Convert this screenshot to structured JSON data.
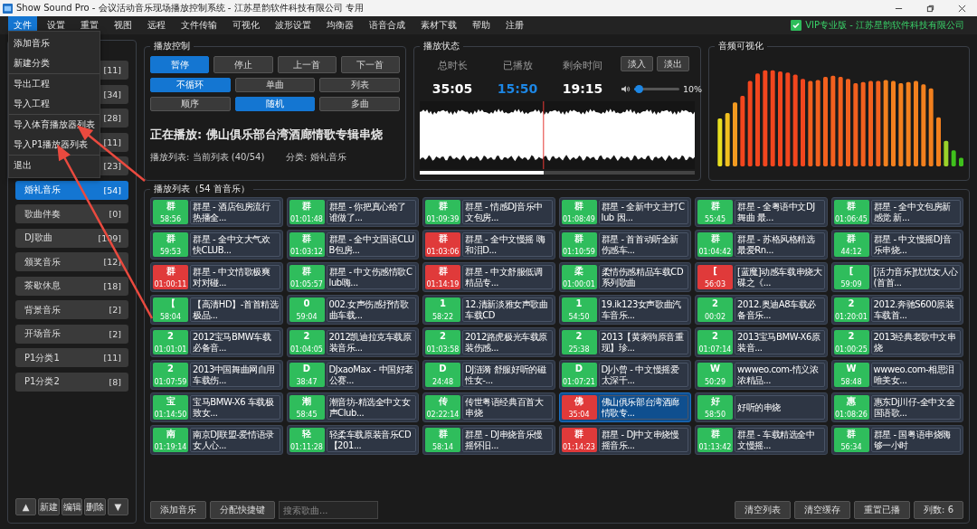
{
  "title_bar": {
    "title": "Show Sound Pro - 会议活动音乐现场播放控制系统 - 江苏星韵软件科技有限公司 专用"
  },
  "menu_bar": {
    "items": [
      {
        "label": "文件",
        "selected": true
      },
      {
        "label": "设置",
        "selected": false
      },
      {
        "label": "重置",
        "selected": false
      },
      {
        "label": "视图",
        "selected": false
      },
      {
        "label": "远程",
        "selected": false
      },
      {
        "label": "文件传输",
        "selected": false
      },
      {
        "label": "可视化",
        "selected": false
      },
      {
        "label": "波形设置",
        "selected": false
      },
      {
        "label": "均衡器",
        "selected": false
      },
      {
        "label": "语音合成",
        "selected": false
      },
      {
        "label": "素材下载",
        "selected": false
      },
      {
        "label": "帮助",
        "selected": false
      },
      {
        "label": "注册",
        "selected": false
      }
    ],
    "license": {
      "checked": true,
      "label": "VIP专业版 - 江苏星韵软件科技有限公司"
    }
  },
  "file_menu": {
    "groups": [
      [
        "添加音乐",
        "新建分类"
      ],
      [
        "导出工程",
        "导入工程"
      ],
      [
        "导入体育播放器列表",
        "导入P1播放器列表"
      ],
      [
        "退出"
      ]
    ]
  },
  "sidebar": {
    "categories": [
      {
        "count": "[11]",
        "selected": false
      },
      {
        "count": "[34]",
        "selected": false
      },
      {
        "count": "[28]",
        "selected": false
      },
      {
        "count": "[11]",
        "selected": false
      },
      {
        "count": "[23]",
        "selected": false
      },
      {
        "label": "婚礼音乐",
        "count": "[54]",
        "selected": true
      },
      {
        "label": "歌曲伴奏",
        "count": "[0]",
        "selected": false
      },
      {
        "label": "DJ歌曲",
        "count": "[109]",
        "selected": false
      },
      {
        "label": "颁奖音乐",
        "count": "[12]",
        "selected": false
      },
      {
        "label": "茶歇休息",
        "count": "[18]",
        "selected": false
      },
      {
        "label": "背景音乐",
        "count": "[2]",
        "selected": false
      },
      {
        "label": "开场音乐",
        "count": "[2]",
        "selected": false
      },
      {
        "label": "P1分类1",
        "count": "[11]",
        "selected": false
      },
      {
        "label": "P1分类2",
        "count": "[8]",
        "selected": false
      }
    ],
    "buttons": [
      "▲",
      "新建",
      "编辑",
      "删除",
      "▼"
    ]
  },
  "playback_control": {
    "title": "播放控制",
    "transport": [
      {
        "label": "暂停",
        "selected": true
      },
      {
        "label": "停止",
        "selected": false
      },
      {
        "label": "上一首",
        "selected": false
      },
      {
        "label": "下一首",
        "selected": false
      }
    ],
    "loop_modes": [
      {
        "label": "不循环",
        "selected": true
      },
      {
        "label": "单曲",
        "selected": false
      },
      {
        "label": "列表",
        "selected": false
      }
    ],
    "order_modes": [
      {
        "label": "顺序",
        "selected": false
      },
      {
        "label": "随机",
        "selected": true
      },
      {
        "label": "多曲",
        "selected": false
      }
    ],
    "now_playing": "正在播放: 佛山俱乐部台湾酒廊情歌专辑串烧",
    "playlist_info": "播放列表: 当前列表 (40/54)",
    "category_info": "分类: 婚礼音乐"
  },
  "playback_status": {
    "title": "播放状态",
    "stats": [
      {
        "label": "总时长",
        "value": "35:05",
        "highlight": false
      },
      {
        "label": "已播放",
        "value": "15:50",
        "highlight": true
      },
      {
        "label": "剩余时间",
        "value": "19:15",
        "highlight": false
      }
    ],
    "buttons": [
      "淡入",
      "淡出"
    ],
    "volume": {
      "level": 0.1,
      "reading": "10%"
    },
    "progress": {
      "level": 0.45
    }
  },
  "visualizer": {
    "title": "音频可视化"
  },
  "playlist": {
    "title": "播放列表（54 首音乐）",
    "tracks": [
      {
        "badge": "群",
        "duration": "58:56",
        "color": "#2fbd5c",
        "title": "群星 - 酒店包房流行热播全...",
        "selected": false
      },
      {
        "badge": "群",
        "duration": "01:01:48",
        "color": "#2fbd5c",
        "title": "群星 - 你把真心给了谁做了...",
        "selected": false
      },
      {
        "badge": "群",
        "duration": "01:09:39",
        "color": "#2fbd5c",
        "title": "群星 - 情感DJ音乐中文包房...",
        "selected": false
      },
      {
        "badge": "群",
        "duration": "01:08:49",
        "color": "#2fbd5c",
        "title": "群星 - 全新中文主打Club 因...",
        "selected": false
      },
      {
        "badge": "群",
        "duration": "55:45",
        "color": "#2fbd5c",
        "title": "群星 - 全粤语中文DJ舞曲 最...",
        "selected": false
      },
      {
        "badge": "群",
        "duration": "01:06:45",
        "color": "#2fbd5c",
        "title": "群星 - 全中文包房新感觉 新...",
        "selected": false
      },
      {
        "badge": "群",
        "duration": "59:53",
        "color": "#2fbd5c",
        "title": "群星 - 全中文大气欢快CLUB...",
        "selected": false
      },
      {
        "badge": "群",
        "duration": "01:03:12",
        "color": "#2fbd5c",
        "title": "群星 - 全中文国语CLUB包房...",
        "selected": false
      },
      {
        "badge": "群",
        "duration": "01:03:06",
        "color": "#e03a3a",
        "title": "群星 - 全中文慢摇 嗨和泪D...",
        "selected": false
      },
      {
        "badge": "群",
        "duration": "01:10:59",
        "color": "#2fbd5c",
        "title": "群星 - 首首动听全新伤感车...",
        "selected": false
      },
      {
        "badge": "群",
        "duration": "01:04:42",
        "color": "#2fbd5c",
        "title": "群星 - 苏格风格精选最爱Rn...",
        "selected": false
      },
      {
        "badge": "群",
        "duration": "44:12",
        "color": "#2fbd5c",
        "title": "群星 - 中文慢摇DJ音乐串烧...",
        "selected": false
      },
      {
        "badge": "群",
        "duration": "01:00:11",
        "color": "#e03a3a",
        "title": "群星 - 中文情歌极爽对对碰...",
        "selected": false
      },
      {
        "badge": "群",
        "duration": "01:05:57",
        "color": "#2fbd5c",
        "title": "群星 - 中文伤感情歌Club嗨...",
        "selected": false
      },
      {
        "badge": "群",
        "duration": "01:14:19",
        "color": "#e03a3a",
        "title": "群星 - 中文舒服低调精品专...",
        "selected": false
      },
      {
        "badge": "柔",
        "duration": "01:00:01",
        "color": "#2fbd5c",
        "title": "柔情伤感精品车载CD系列歌曲",
        "selected": false
      },
      {
        "badge": "[",
        "duration": "56:03",
        "color": "#e03a3a",
        "title": "[蓝魔]动感车载串烧大碟之《...",
        "selected": false
      },
      {
        "badge": "[",
        "duration": "59:09",
        "color": "#2fbd5c",
        "title": "[活力音乐]忧忧女人心(首首...",
        "selected": false
      },
      {
        "badge": "【",
        "duration": "58:04",
        "color": "#2fbd5c",
        "title": "【高清HD】-首首精选极品...",
        "selected": false
      },
      {
        "badge": "0",
        "duration": "59:04",
        "color": "#2fbd5c",
        "title": "002.女声伤感抒情歌曲车载...",
        "selected": false
      },
      {
        "badge": "1",
        "duration": "58:22",
        "color": "#2fbd5c",
        "title": "12.清新淡雅女声歌曲车载CD",
        "selected": false
      },
      {
        "badge": "1",
        "duration": "54:50",
        "color": "#2fbd5c",
        "title": "19.ik123女声歌曲汽车音乐...",
        "selected": false
      },
      {
        "badge": "2",
        "duration": "00:02",
        "color": "#2fbd5c",
        "title": "2012.奥迪A8车载必备音乐...",
        "selected": false
      },
      {
        "badge": "2",
        "duration": "01:20:01",
        "color": "#2fbd5c",
        "title": "2012.奔驰S600原装车载首...",
        "selected": false
      },
      {
        "badge": "2",
        "duration": "01:01:01",
        "color": "#2fbd5c",
        "title": "2012宝马BMW车载必备音...",
        "selected": false
      },
      {
        "badge": "2",
        "duration": "01:04:05",
        "color": "#2fbd5c",
        "title": "2012凯迪拉克车载原装音乐...",
        "selected": false
      },
      {
        "badge": "2",
        "duration": "01:03:58",
        "color": "#2fbd5c",
        "title": "2012路虎极光车载原装伤感...",
        "selected": false
      },
      {
        "badge": "2",
        "duration": "25:38",
        "color": "#2fbd5c",
        "title": "2013【黄家驹原音重现】珍...",
        "selected": false
      },
      {
        "badge": "2",
        "duration": "01:07:14",
        "color": "#2fbd5c",
        "title": "2013宝马BMW-X6原装音...",
        "selected": false
      },
      {
        "badge": "2",
        "duration": "01:00:25",
        "color": "#2fbd5c",
        "title": "2013经典老歌中文串烧",
        "selected": false
      },
      {
        "badge": "2",
        "duration": "01:07:59",
        "color": "#2fbd5c",
        "title": "2013中国舞曲网自用车载伤...",
        "selected": false
      },
      {
        "badge": "D",
        "duration": "38:47",
        "color": "#2fbd5c",
        "title": "DJxaoMax - 中国好老公赛...",
        "selected": false
      },
      {
        "badge": "D",
        "duration": "24:48",
        "color": "#2fbd5c",
        "title": "DJ涟漪 舒服好听的磁性女-...",
        "selected": false
      },
      {
        "badge": "D",
        "duration": "01:07:21",
        "color": "#2fbd5c",
        "title": "DJ小曾 - 中文慢摇爱太深千...",
        "selected": false
      },
      {
        "badge": "W",
        "duration": "50:29",
        "color": "#2fbd5c",
        "title": "wwweo.com-情义浓浓精品...",
        "selected": false
      },
      {
        "badge": "W",
        "duration": "58:48",
        "color": "#2fbd5c",
        "title": "wwweo.com-相思泪唯美女...",
        "selected": false
      },
      {
        "badge": "宝",
        "duration": "01:14:50",
        "color": "#2fbd5c",
        "title": "宝马BMW-X6 车载极致女...",
        "selected": false
      },
      {
        "badge": "潮",
        "duration": "58:45",
        "color": "#2fbd5c",
        "title": "潮音坊-精选全中文女声Club...",
        "selected": false
      },
      {
        "badge": "传",
        "duration": "02:22:14",
        "color": "#2fbd5c",
        "title": "传世粤语经典百首大串烧",
        "selected": false
      },
      {
        "badge": "佛",
        "duration": "35:04",
        "color": "#e03a3a",
        "title": "佛山俱乐部台湾酒廊情歌专...",
        "selected": true
      },
      {
        "badge": "好",
        "duration": "58:50",
        "color": "#2fbd5c",
        "title": "好听的串烧",
        "selected": false
      },
      {
        "badge": "惠",
        "duration": "01:08:26",
        "color": "#2fbd5c",
        "title": "惠东Dj川仔-全中文全国语歌...",
        "selected": false
      },
      {
        "badge": "南",
        "duration": "01:19:14",
        "color": "#2fbd5c",
        "title": "南京DJ联盟-爱情语录女人心...",
        "selected": false
      },
      {
        "badge": "轻",
        "duration": "01:11:28",
        "color": "#2fbd5c",
        "title": "轻柔车载原装音乐CD【201...",
        "selected": false
      },
      {
        "badge": "群",
        "duration": "58:14",
        "color": "#2fbd5c",
        "title": "群星 - DJ串烧音乐慢摇怀旧...",
        "selected": false
      },
      {
        "badge": "群",
        "duration": "01:14:23",
        "color": "#e03a3a",
        "title": "群星 - DJ中文串烧慢摇音乐...",
        "selected": false
      },
      {
        "badge": "群",
        "duration": "01:13:42",
        "color": "#2fbd5c",
        "title": "群星 - 车载精选全中文慢摇...",
        "selected": false
      },
      {
        "badge": "群",
        "duration": "56:34",
        "color": "#2fbd5c",
        "title": "群星 - 国粤语串烧嗨够一小时",
        "selected": false
      }
    ]
  },
  "bottom_bar": {
    "left_buttons": [
      "添加音乐",
      "分配快捷键"
    ],
    "search": {
      "placeholder": "搜索歌曲..."
    },
    "right_buttons": [
      "清空列表",
      "清空缓存",
      "重置已播",
      "列数: 6"
    ]
  }
}
